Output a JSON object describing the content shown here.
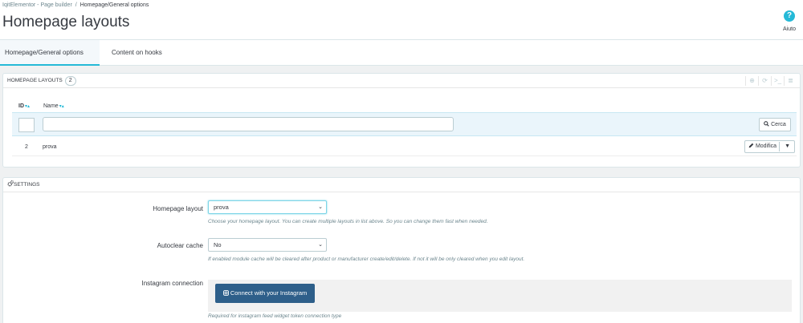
{
  "breadcrumb": {
    "parent": "IqitElementor - Page builder",
    "separator": "/",
    "current": "Homepage/General options"
  },
  "page_title": "Homepage layouts",
  "help": {
    "icon": "?",
    "label": "Aiuto"
  },
  "tabs": [
    {
      "label": "Homepage/General options",
      "active": true
    },
    {
      "label": "Content on hooks",
      "active": false
    }
  ],
  "layouts_panel": {
    "title": "HOMEPAGE LAYOUTS",
    "count": "2",
    "tools": [
      "⊕",
      "⟳",
      ">_",
      "≣"
    ],
    "columns": {
      "id": "ID",
      "name": "Name",
      "sort_glyph": "▾▴"
    },
    "search_label": "Cerca",
    "rows": [
      {
        "id": "2",
        "name": "prova",
        "edit_label": "Modifica"
      }
    ]
  },
  "settings_panel": {
    "title": "SETTINGS",
    "homepage_layout": {
      "label": "Homepage layout",
      "value": "prova",
      "help": "Choose your homepage layout. You can create multiple layouts in list above. So you can change them fast when needed."
    },
    "autoclear_cache": {
      "label": "Autoclear cache",
      "value": "No",
      "help": "If enabled module cache will be cleared after product or manufacturer create/edit/delete. If not it will be only cleared when you edit layout."
    },
    "instagram": {
      "label": "Instagram connection",
      "button": "Connect with your Instagram",
      "help": "Required for instagram feed widget token connection type"
    }
  },
  "colors": {
    "accent": "#25b9d7",
    "instagram_button": "#2e5f8a",
    "background": "#eff1f2"
  },
  "icons": {
    "help": "help-circle-icon",
    "search": "search-icon",
    "edit": "pencil-icon",
    "settings": "cogs-icon",
    "instagram": "instagram-icon"
  }
}
